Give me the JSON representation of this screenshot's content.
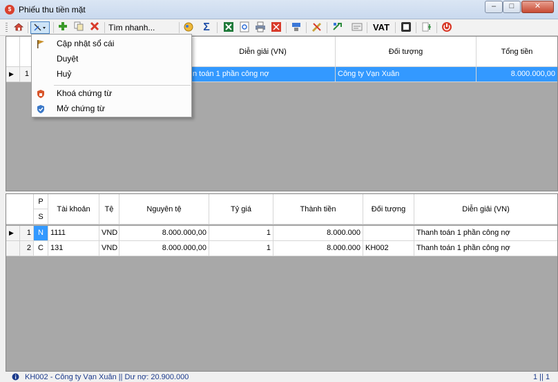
{
  "window": {
    "title": "Phiếu thu tiền mặt",
    "min": "–",
    "max": "□",
    "close": "✕"
  },
  "toolbar": {
    "quick_search": "Tìm nhanh...",
    "vat": "VAT",
    "icons": [
      "home-icon",
      "post-icon",
      "add-icon",
      "copy-icon",
      "delete-icon",
      "filter-icon",
      "sum-icon",
      "excel-icon",
      "preview-icon",
      "print-icon",
      "pdf-icon",
      "network-icon",
      "tools-icon",
      "transfer-icon",
      "form-icon",
      "calendar-icon",
      "grid-icon",
      "power-icon"
    ]
  },
  "menu": {
    "items": [
      {
        "label": "Cập nhật sổ cái",
        "icon": "flag-icon"
      },
      {
        "label": "Duyệt",
        "icon": ""
      },
      {
        "label": "Huỷ",
        "icon": ""
      },
      {
        "label": "Khoá chứng từ",
        "icon": "lock-shield-icon"
      },
      {
        "label": "Mở chứng từ",
        "icon": "unlock-shield-icon"
      }
    ]
  },
  "top_grid": {
    "headers": [
      "Diễn giải (VN)",
      "Đối tượng",
      "Tổng tiền"
    ],
    "rows": [
      {
        "index": "1",
        "dien_giai": "n toán 1 phần công nợ",
        "doi_tuong": "Công ty Vạn Xuân",
        "tong_tien": "8.000.000,00"
      }
    ]
  },
  "bottom_grid": {
    "headers": {
      "ps_top": "P",
      "ps_bottom": "S",
      "tai_khoan": "Tài khoản",
      "te": "Tệ",
      "nguyen_te": "Nguyên tệ",
      "ty_gia": "Tỷ giá",
      "thanh_tien": "Thành tiền",
      "doi_tuong": "Đối tượng",
      "dien_giai": "Diễn giải (VN)"
    },
    "rows": [
      {
        "index": "1",
        "ps": "N",
        "tai_khoan": "1111",
        "te": "VND",
        "nguyen_te": "8.000.000,00",
        "ty_gia": "1",
        "thanh_tien": "8.000.000",
        "doi_tuong": "",
        "dien_giai": "Thanh toán 1 phần công nợ"
      },
      {
        "index": "2",
        "ps": "C",
        "tai_khoan": "131",
        "te": "VND",
        "nguyen_te": "8.000.000,00",
        "ty_gia": "1",
        "thanh_tien": "8.000.000",
        "doi_tuong": "KH002",
        "dien_giai": "Thanh toán 1 phần công nợ"
      }
    ]
  },
  "status": {
    "text": "KH002 - Công ty Vạn Xuân || Dư nợ: 20.900.000",
    "page": "1 || 1"
  }
}
